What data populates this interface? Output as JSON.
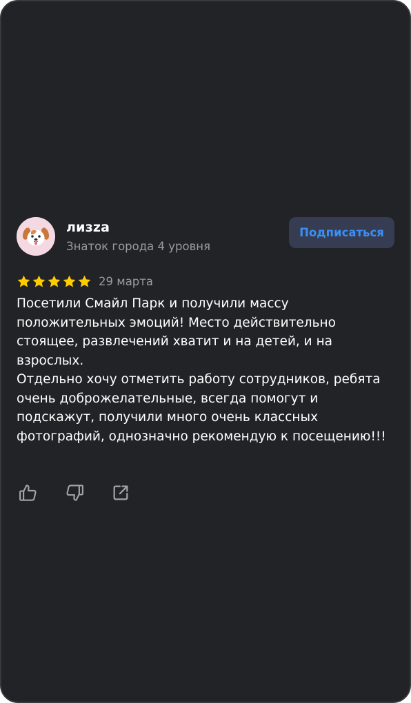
{
  "review": {
    "author": {
      "name": "лизza",
      "rank": "Знаток города 4 уровня",
      "avatar": "puppy-avatar"
    },
    "subscribe_label": "Подписаться",
    "rating": 5,
    "date": "29 марта",
    "paragraphs": [
      "Посетили Смайл Парк и получили массу положительных эмоций! Место действительно стоящее, развлечений хватит и на детей, и на взрослых.",
      "Отдельно хочу отметить работу сотрудников, ребята очень доброжелательные, всегда помогут и подскажут, получили много очень классных фотографий, однозначно рекомендую к посещению!!!"
    ],
    "actions": [
      {
        "name": "like",
        "icon": "thumbs-up-icon"
      },
      {
        "name": "dislike",
        "icon": "thumbs-down-icon"
      },
      {
        "name": "share",
        "icon": "share-icon"
      }
    ]
  },
  "colors": {
    "background": "#222327",
    "text": "#ffffff",
    "secondary_text": "#9a9ba1",
    "accent": "#3b8ff5",
    "button_bg": "#363c52",
    "star": "#ffcc00"
  }
}
